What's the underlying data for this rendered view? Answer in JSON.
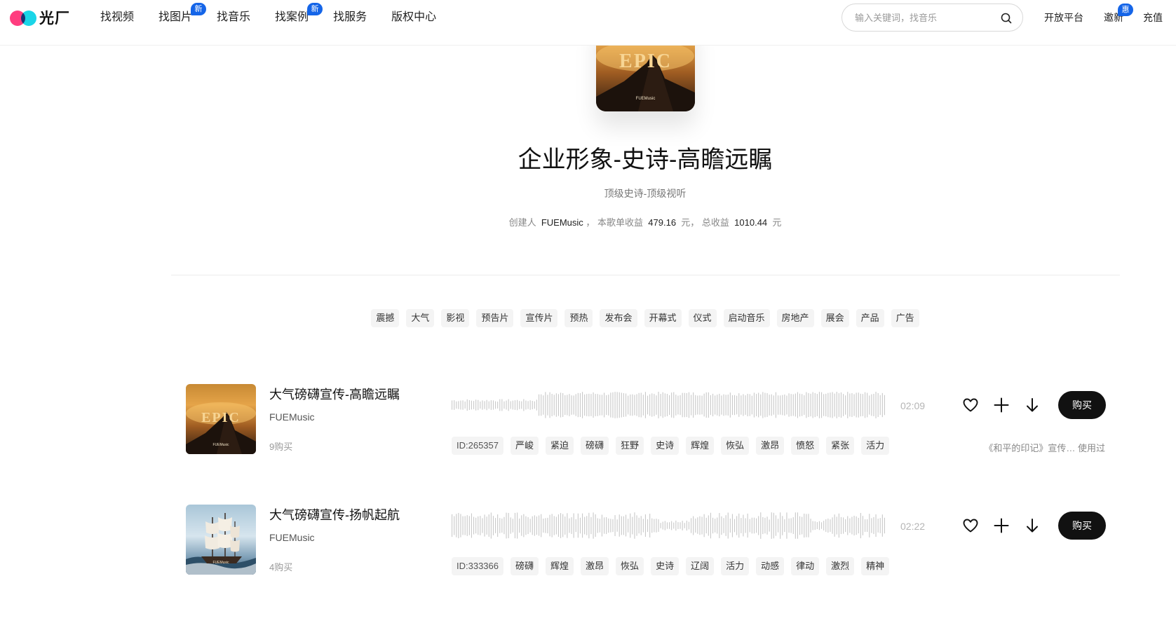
{
  "header": {
    "logo_text": "光厂",
    "nav": [
      {
        "label": "找视频",
        "badge": ""
      },
      {
        "label": "找图片",
        "badge": "新"
      },
      {
        "label": "找音乐",
        "badge": ""
      },
      {
        "label": "找案例",
        "badge": "新"
      },
      {
        "label": "找服务",
        "badge": ""
      },
      {
        "label": "版权中心",
        "badge": ""
      }
    ],
    "search_placeholder": "输入关键词，找音乐",
    "open_platform": "开放平台",
    "invite": "邀新",
    "invite_badge": "惠",
    "recharge": "充值"
  },
  "playlist": {
    "cover_text": "EPIC",
    "cover_brand": "FUEMusic",
    "title": "企业形象-史诗-高瞻远瞩",
    "subtitle": "顶级史诗-顶级视听",
    "creator_label": "创建人",
    "creator": "FUEMusic",
    "sep": "，",
    "single_income_label": "本歌单收益",
    "single_income": "479.16",
    "unit1": "元，",
    "total_income_label": "总收益",
    "total_income": "1010.44",
    "unit2": "元",
    "tags": [
      "震撼",
      "大气",
      "影视",
      "预告片",
      "宣传片",
      "预热",
      "发布会",
      "开幕式",
      "仪式",
      "启动音乐",
      "房地产",
      "展会",
      "产品",
      "广告"
    ]
  },
  "tracks": [
    {
      "name": "大气磅礴宣传-高瞻远瞩",
      "artist": "FUEMusic",
      "buys": "9购买",
      "duration": "02:09",
      "buy_label": "购买",
      "cover_text": "EPIC",
      "cover_brand": "FUEMusic",
      "id": "ID:265357",
      "tags": [
        "严峻",
        "紧迫",
        "磅礴",
        "狂野",
        "史诗",
        "辉煌",
        "恢弘",
        "激昂",
        "愤怒",
        "紧张",
        "活力"
      ],
      "used_by": "《和平的印记》宣传…  使用过"
    },
    {
      "name": "大气磅礴宣传-扬帆起航",
      "artist": "FUEMusic",
      "buys": "4购买",
      "duration": "02:22",
      "buy_label": "购买",
      "cover_text": "",
      "cover_brand": "FUEMusic",
      "id": "ID:333366",
      "tags": [
        "磅礴",
        "辉煌",
        "激昂",
        "恢弘",
        "史诗",
        "辽阔",
        "活力",
        "动感",
        "律动",
        "激烈",
        "精神"
      ],
      "used_by": ""
    }
  ],
  "icons": [
    "heart-icon",
    "plus-icon",
    "download-icon",
    "search-icon"
  ]
}
